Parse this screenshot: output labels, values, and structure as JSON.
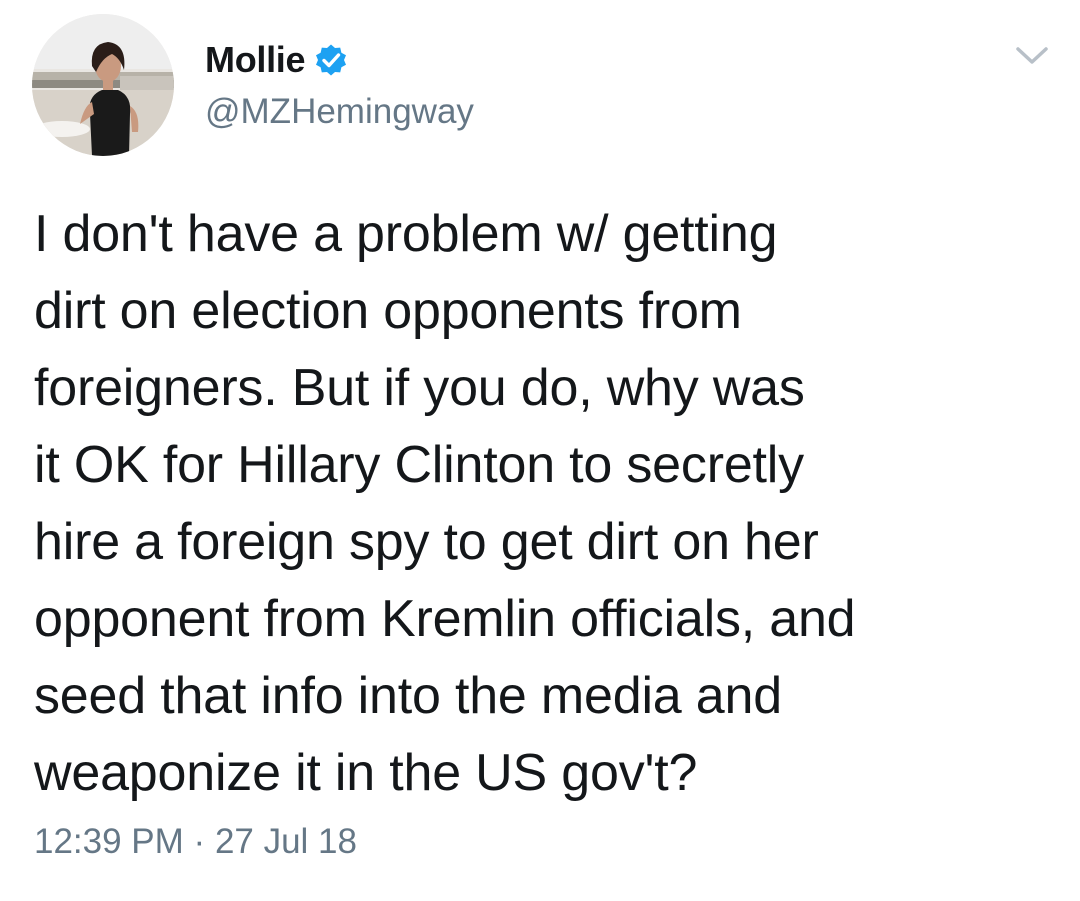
{
  "author": {
    "display_name": "Mollie",
    "handle": "@MZHemingway",
    "verified": true,
    "avatar_icon": "profile-photo",
    "verified_icon": "verified-badge-icon",
    "verified_color": "#1da1f2"
  },
  "menu": {
    "icon": "chevron-down-icon"
  },
  "tweet": {
    "lines": [
      "I don't have a problem w/ getting",
      "dirt on election opponents from",
      "foreigners. But if you do, why was",
      "it OK for Hillary Clinton to secretly",
      "hire a foreign spy to get dirt on her",
      "opponent from Kremlin officials, and",
      "seed that info into the media and",
      "weaponize it in the US gov't?"
    ],
    "time": "12:39 PM",
    "separator": "·",
    "date": "27 Jul 18"
  },
  "colors": {
    "text": "#14171a",
    "secondary": "#657786",
    "accent": "#1da1f2"
  }
}
